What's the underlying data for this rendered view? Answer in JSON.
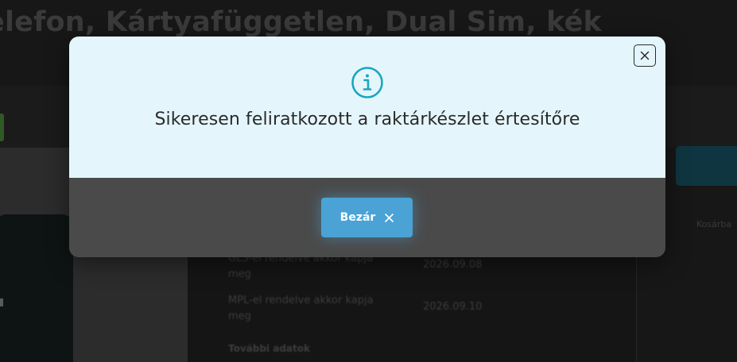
{
  "background": {
    "title": "elefon, Kártyafüggetlen, Dual Sim, kék",
    "rows": [
      {
        "label": "GLS-el rendelve akkor kapja meg",
        "value": "2026.09.08"
      },
      {
        "label": "MPL-el rendelve akkor kapja meg",
        "value": "2026.09.10"
      }
    ],
    "more_link": "További adatok",
    "right_text": "Kosárba"
  },
  "modal": {
    "message": "Sikeresen feliratkozott a raktárkészlet értesítőre",
    "close_button_label": "Bezár",
    "info_icon": "info-circle-icon",
    "dismiss_icon": "close-icon"
  },
  "colors": {
    "modal_top_bg": "#e4f6fc",
    "modal_bottom_bg": "#4a4a4a",
    "info_icon": "#1aa6bf",
    "button_bg": "#4aa3d4"
  }
}
